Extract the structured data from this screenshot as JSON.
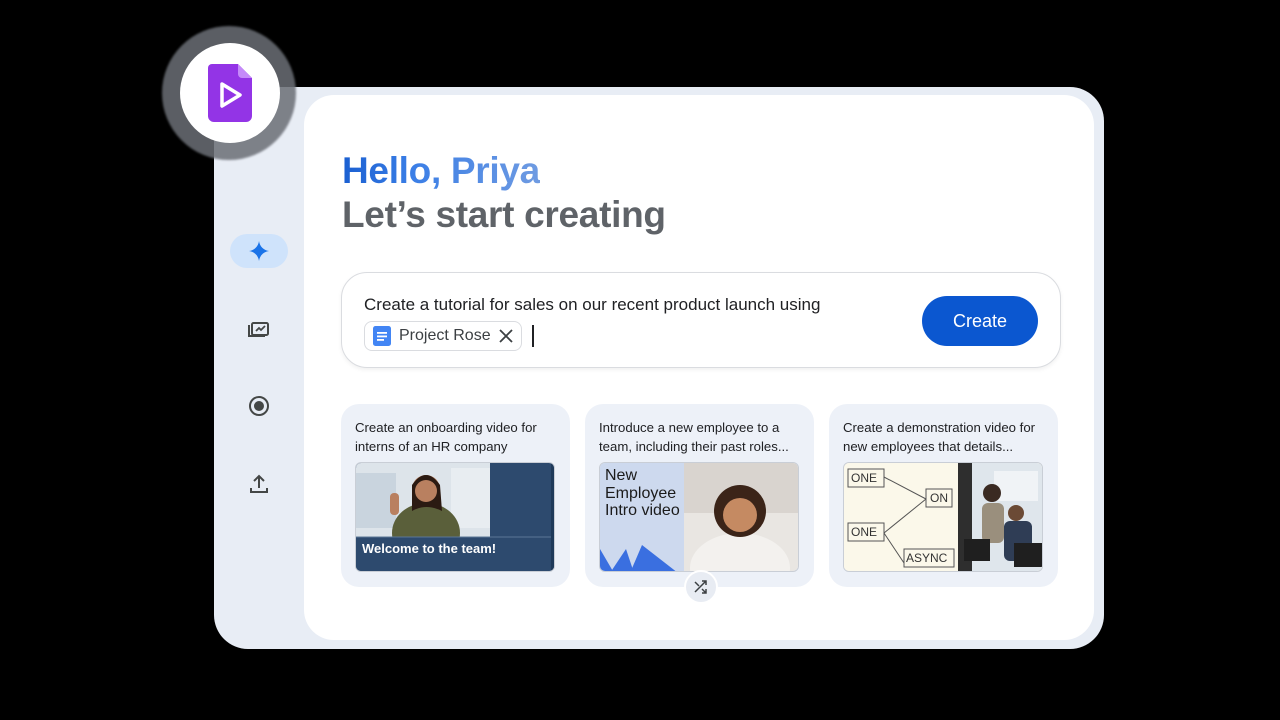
{
  "greeting": {
    "hello": "Hello, Priya",
    "subtitle": "Let’s start creating"
  },
  "prompt": {
    "text": "Create a tutorial for sales on our recent product launch using",
    "chip_label": "Project Rose",
    "create_label": "Create"
  },
  "sidebar": {
    "items": [
      {
        "icon": "sparkle-icon",
        "active": true
      },
      {
        "icon": "video-library-icon",
        "active": false
      },
      {
        "icon": "record-icon",
        "active": false
      },
      {
        "icon": "upload-icon",
        "active": false
      }
    ]
  },
  "cards": [
    {
      "text": "Create an onboarding video for interns of an HR company",
      "thumb_caption": "Welcome to the team!"
    },
    {
      "text": "Introduce a new employee to a team, including their past roles...",
      "thumb_title": "New Employee Intro video"
    },
    {
      "text": "Create a demonstration video for new employees that details...",
      "diagram_labels": [
        "ONE",
        "ON",
        "ONE",
        "ASYNC"
      ]
    }
  ],
  "colors": {
    "accent": "#0b57d0",
    "logo": "#9334e6",
    "sidebar_active": "#cfe3fb",
    "card_bg": "#edf1f8"
  }
}
